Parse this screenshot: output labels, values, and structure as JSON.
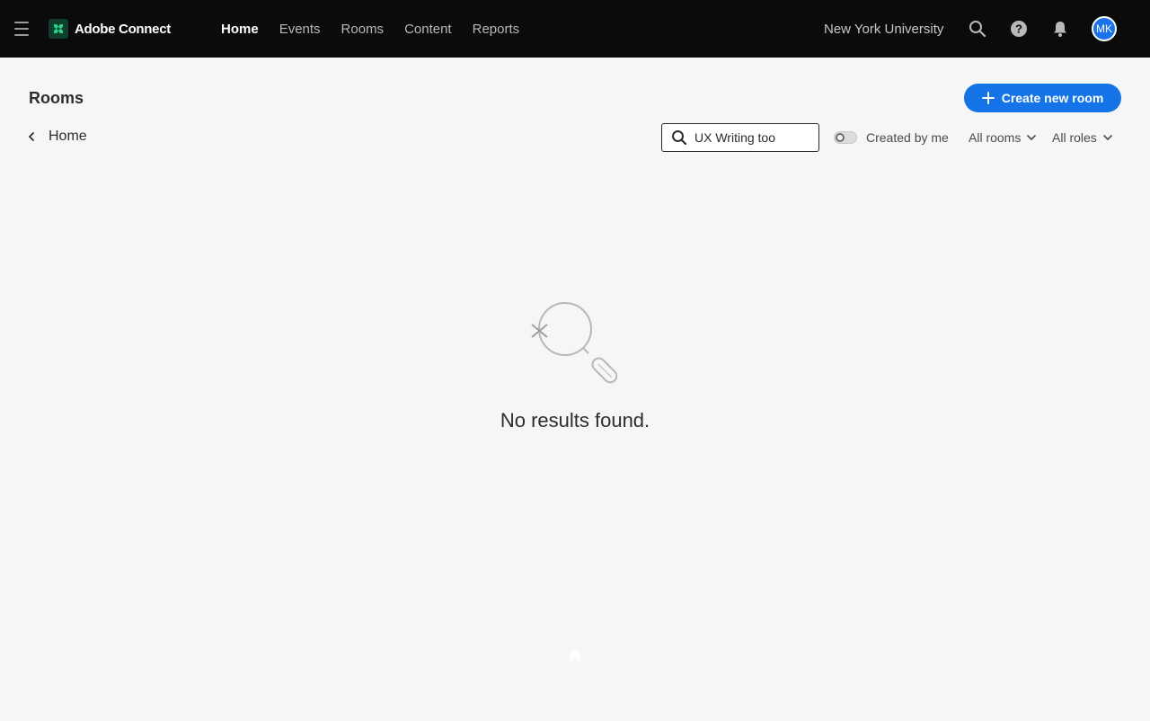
{
  "app": {
    "brand_name": "Adobe Connect",
    "brand_color": "#0f3d2e",
    "accent_color": "#1473e6"
  },
  "nav": {
    "items": [
      {
        "label": "Home",
        "active": true
      },
      {
        "label": "Events",
        "active": false
      },
      {
        "label": "Rooms",
        "active": false
      },
      {
        "label": "Content",
        "active": false
      },
      {
        "label": "Reports",
        "active": false
      }
    ],
    "org_name": "New York University",
    "icons": [
      "menu-icon",
      "search-icon",
      "help-icon",
      "notification-bell-icon"
    ],
    "avatar_initials": "MK"
  },
  "page": {
    "title": "Rooms",
    "create_button_label": "Create new room",
    "breadcrumb_label": "Home"
  },
  "filters": {
    "search_value": "UX Writing too",
    "toggle_label": "Created by me",
    "toggle_on": false,
    "rooms_dropdown": "All rooms",
    "roles_dropdown": "All roles"
  },
  "empty_state": {
    "message": "No results found.",
    "icon": "no-results-magnifier-icon"
  }
}
